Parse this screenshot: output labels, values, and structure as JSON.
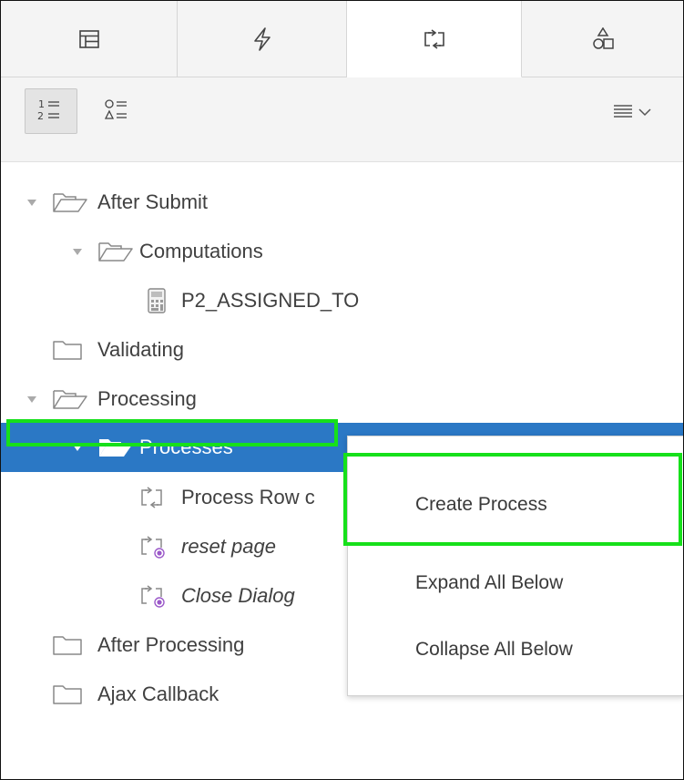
{
  "tabs": [
    {
      "name": "rendering-tab",
      "icon": "rendering-tree-icon"
    },
    {
      "name": "dynamic-actions-tab",
      "icon": "lightning-icon"
    },
    {
      "name": "processing-tab",
      "icon": "processing-arrows-icon",
      "active": true
    },
    {
      "name": "shared-components-tab",
      "icon": "shapes-icon"
    }
  ],
  "toolbar": {
    "view_by_processing_order": {
      "icon": "numbered-list-icon",
      "pressed": true
    },
    "view_by_component_type": {
      "icon": "shapes-list-icon",
      "pressed": false
    },
    "menu": {
      "icon": "menu-lines-icon",
      "caret": "chevron-down-icon"
    }
  },
  "tree": [
    {
      "label": "After Submit",
      "type": "folder-open",
      "expanded": true
    },
    {
      "label": "Computations",
      "type": "folder-open",
      "expanded": true
    },
    {
      "label": "P2_ASSIGNED_TO",
      "type": "computation"
    },
    {
      "label": "Validating",
      "type": "folder"
    },
    {
      "label": "Processing",
      "type": "folder-open",
      "expanded": true
    },
    {
      "label": "Processes",
      "type": "folder-open",
      "expanded": true,
      "selected": true
    },
    {
      "label": "Process Row c",
      "type": "process"
    },
    {
      "label": "reset page",
      "type": "process-disabled",
      "italic": true
    },
    {
      "label": "Close Dialog",
      "type": "process-disabled",
      "italic": true
    },
    {
      "label": "After Processing",
      "type": "folder"
    },
    {
      "label": "Ajax Callback",
      "type": "folder"
    }
  ],
  "context_menu": {
    "items": [
      "Create Process",
      "Expand All Below",
      "Collapse All Below"
    ],
    "highlighted": "Create Process"
  },
  "colors": {
    "selected_row": "#2b78c5",
    "highlight_outline": "#16e01a",
    "disabled_marker": "#9b59c9"
  }
}
